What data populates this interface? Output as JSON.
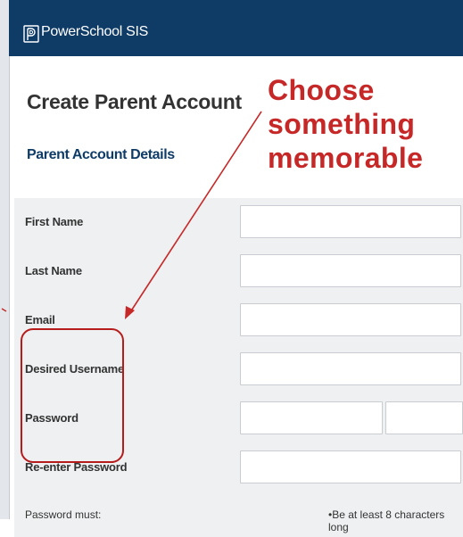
{
  "app": {
    "brand": "PowerSchool SIS"
  },
  "page": {
    "title": "Create Parent Account",
    "section_title": "Parent Account Details"
  },
  "annotation": {
    "line1": "Choose",
    "line2": "something",
    "line3": "memorable"
  },
  "form": {
    "fields": [
      {
        "label": "First Name",
        "value": ""
      },
      {
        "label": "Last Name",
        "value": ""
      },
      {
        "label": "Email",
        "value": ""
      },
      {
        "label": "Desired Username",
        "value": ""
      },
      {
        "label": "Password",
        "value": ""
      },
      {
        "label": "Re-enter Password",
        "value": ""
      }
    ],
    "password_help_label": "Password must:",
    "password_rule": "•Be at least 8 characters long"
  },
  "colors": {
    "header": "#0f3b67",
    "annotation": "#c62828",
    "row_shade": "#eef0f2"
  }
}
